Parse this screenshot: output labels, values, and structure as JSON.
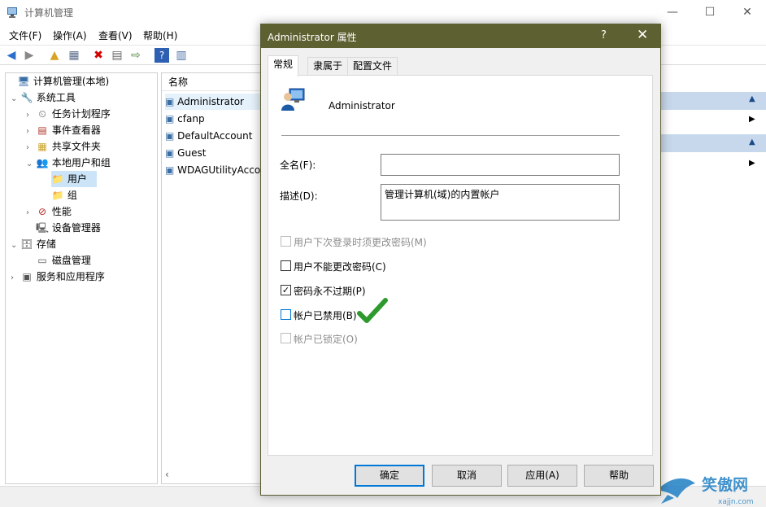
{
  "window": {
    "title": "计算机管理",
    "controls": [
      "—",
      "☐",
      "✕"
    ]
  },
  "menu": [
    "文件(F)",
    "操作(A)",
    "查看(V)",
    "帮助(H)"
  ],
  "tree": {
    "items": [
      {
        "label": "计算机管理(本地)",
        "icon": "computer-management-icon",
        "glyph": "🖥",
        "exp": ""
      },
      {
        "label": "系统工具",
        "icon": "tools-icon",
        "glyph": "🔧",
        "exp": "⌄"
      },
      {
        "label": "任务计划程序",
        "icon": "clock-icon",
        "glyph": "⏲",
        "exp": "›"
      },
      {
        "label": "事件查看器",
        "icon": "event-viewer-icon",
        "glyph": "▤",
        "exp": "›"
      },
      {
        "label": "共享文件夹",
        "icon": "shared-folder-icon",
        "glyph": "▦",
        "exp": "›"
      },
      {
        "label": "本地用户和组",
        "icon": "users-icon",
        "glyph": "👥",
        "exp": "⌄"
      },
      {
        "label": "用户",
        "icon": "folder-icon",
        "glyph": "📁",
        "exp": ""
      },
      {
        "label": "组",
        "icon": "folder-icon",
        "glyph": "📁",
        "exp": ""
      },
      {
        "label": "性能",
        "icon": "performance-icon",
        "glyph": "⊘",
        "exp": "›"
      },
      {
        "label": "设备管理器",
        "icon": "device-manager-icon",
        "glyph": "🖳",
        "exp": ""
      },
      {
        "label": "存储",
        "icon": "storage-icon",
        "glyph": "🗄",
        "exp": "⌄"
      },
      {
        "label": "磁盘管理",
        "icon": "disk-icon",
        "glyph": "▭",
        "exp": ""
      },
      {
        "label": "服务和应用程序",
        "icon": "services-icon",
        "glyph": "▣",
        "exp": "›"
      }
    ]
  },
  "list": {
    "header": "名称",
    "rows": [
      "Administrator",
      "cfanp",
      "DefaultAccount",
      "Guest",
      "WDAGUtilityAcco"
    ]
  },
  "dialog": {
    "title": "Administrator 属性",
    "help": "?",
    "close": "✕",
    "tabs": [
      "常规",
      "隶属于",
      "配置文件"
    ],
    "username": "Administrator",
    "fullname_label": "全名(F):",
    "fullname_value": "",
    "desc_label": "描述(D):",
    "desc_value": "管理计算机(域)的内置帐户",
    "checkboxes": [
      {
        "label": "用户下次登录时须更改密码(M)",
        "checked": false,
        "disabled": true
      },
      {
        "label": "用户不能更改密码(C)",
        "checked": false,
        "disabled": false
      },
      {
        "label": "密码永不过期(P)",
        "checked": true,
        "disabled": false
      },
      {
        "label": "帐户已禁用(B)",
        "checked": false,
        "disabled": false
      },
      {
        "label": "帐户已锁定(O)",
        "checked": false,
        "disabled": true
      }
    ],
    "buttons": [
      "确定",
      "取消",
      "应用(A)",
      "帮助"
    ]
  },
  "colors": {
    "dialog_title_bg": "#5d6031",
    "accent": "#0078d7",
    "checkmark": "#2e9a2e"
  }
}
